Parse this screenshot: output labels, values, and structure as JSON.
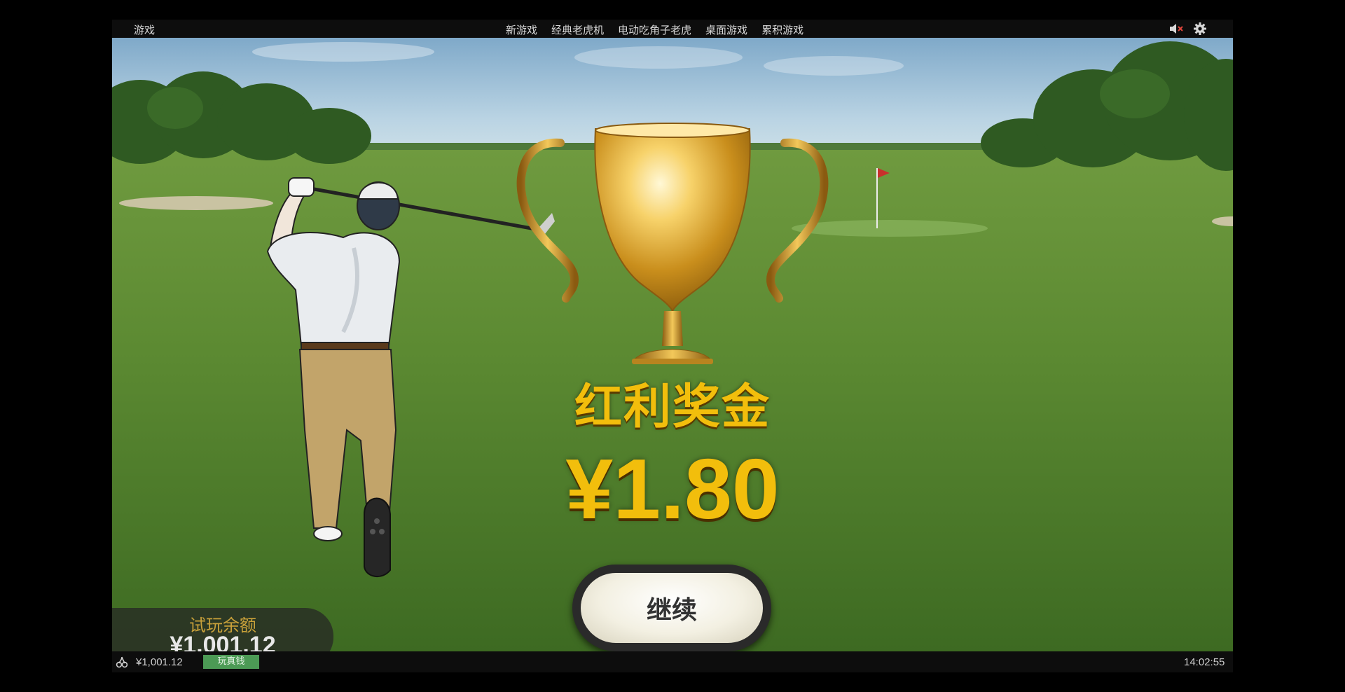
{
  "topbar": {
    "games_label": "游戏",
    "nav": [
      {
        "label": "新游戏"
      },
      {
        "label": "经典老虎机"
      },
      {
        "label": "电动吃角子老虎"
      },
      {
        "label": "桌面游戏"
      },
      {
        "label": "累积游戏"
      }
    ],
    "icons": {
      "mute": "speaker-muted-icon",
      "settings": "gear-icon"
    }
  },
  "bonus": {
    "title": "红利奖金",
    "amount": "¥1.80",
    "continue_label": "继续",
    "color": "#f2be0c"
  },
  "trial_balance": {
    "label": "试玩余额",
    "value": "¥1,001.12"
  },
  "bottombar": {
    "icon": "cherry-icon",
    "balance": "¥1,001.12",
    "real_money_label": "玩真钱",
    "time": "14:02:55",
    "accent": "#4c9a55"
  }
}
